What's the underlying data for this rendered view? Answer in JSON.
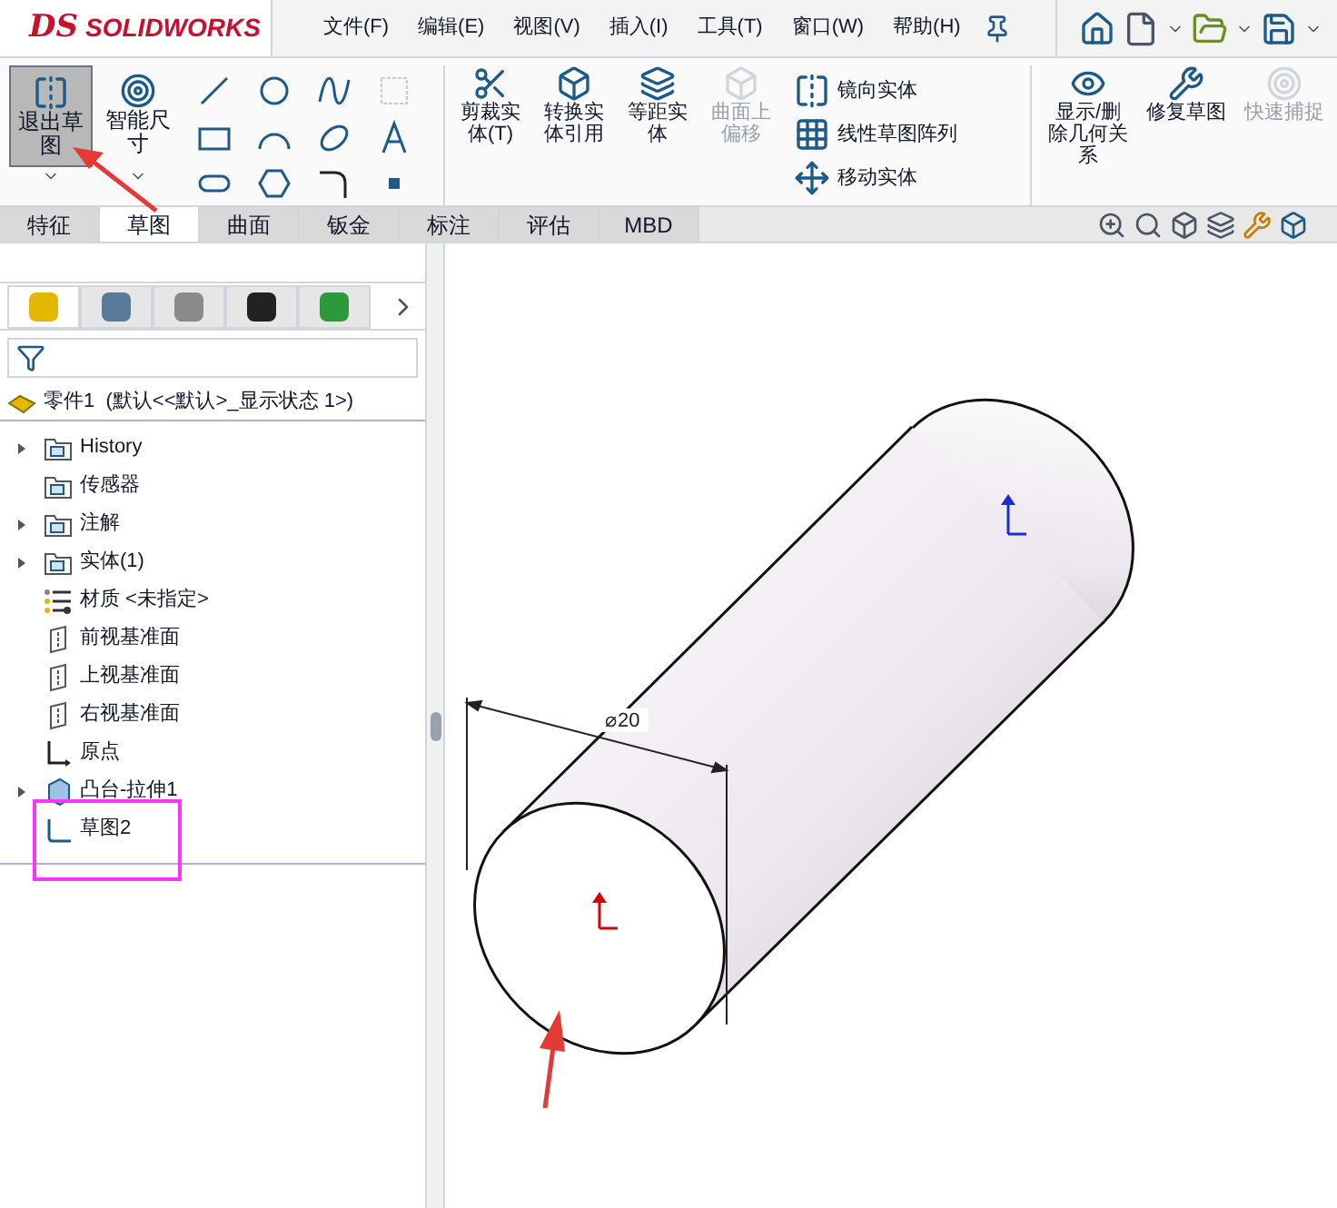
{
  "app": {
    "logo_mark": "DS",
    "logo": "SOLIDWORKS"
  },
  "menu": [
    "文件(F)",
    "编辑(E)",
    "视图(V)",
    "插入(I)",
    "工具(T)",
    "窗口(W)",
    "帮助(H)"
  ],
  "ribbon": {
    "big_buttons": [
      {
        "label": "退出草图",
        "selected": true
      },
      {
        "label": "智能尺寸",
        "selected": false
      }
    ],
    "mid_buttons": [
      {
        "label": "剪裁实体(T)",
        "disabled": false
      },
      {
        "label": "转换实体引用",
        "disabled": false
      },
      {
        "label": "等距实体",
        "disabled": false
      },
      {
        "label": "曲面上偏移",
        "disabled": true
      }
    ],
    "list_buttons": [
      {
        "label": "镜向实体"
      },
      {
        "label": "线性草图阵列"
      },
      {
        "label": "移动实体"
      }
    ],
    "right_buttons": [
      {
        "label": "显示/删除几何关系",
        "disabled": false
      },
      {
        "label": "修复草图",
        "disabled": false
      },
      {
        "label": "快速捕捉",
        "disabled": true
      }
    ]
  },
  "tabs": [
    {
      "label": "特征",
      "selected": false
    },
    {
      "label": "草图",
      "selected": true
    },
    {
      "label": "曲面",
      "selected": false
    },
    {
      "label": "钣金",
      "selected": false
    },
    {
      "label": "标注",
      "selected": false
    },
    {
      "label": "评估",
      "selected": false
    },
    {
      "label": "MBD",
      "selected": false
    }
  ],
  "tree": {
    "root": "零件1  (默认<<默认>_显示状态 1>)",
    "items": [
      {
        "label": "History",
        "kind": "folder",
        "expandable": true
      },
      {
        "label": "传感器",
        "kind": "folder",
        "expandable": false
      },
      {
        "label": "注解",
        "kind": "folder",
        "expandable": true
      },
      {
        "label": "实体(1)",
        "kind": "folder",
        "expandable": true
      },
      {
        "label": "材质 <未指定>",
        "kind": "material",
        "expandable": false
      },
      {
        "label": "前视基准面",
        "kind": "plane",
        "expandable": false
      },
      {
        "label": "上视基准面",
        "kind": "plane",
        "expandable": false
      },
      {
        "label": "右视基准面",
        "kind": "plane",
        "expandable": false
      },
      {
        "label": "原点",
        "kind": "origin",
        "expandable": false
      },
      {
        "label": "凸台-拉伸1",
        "kind": "feature",
        "expandable": true
      },
      {
        "label": "草图2",
        "kind": "sketch",
        "expandable": false
      }
    ]
  },
  "canvas": {
    "dimension": "⌀20"
  }
}
